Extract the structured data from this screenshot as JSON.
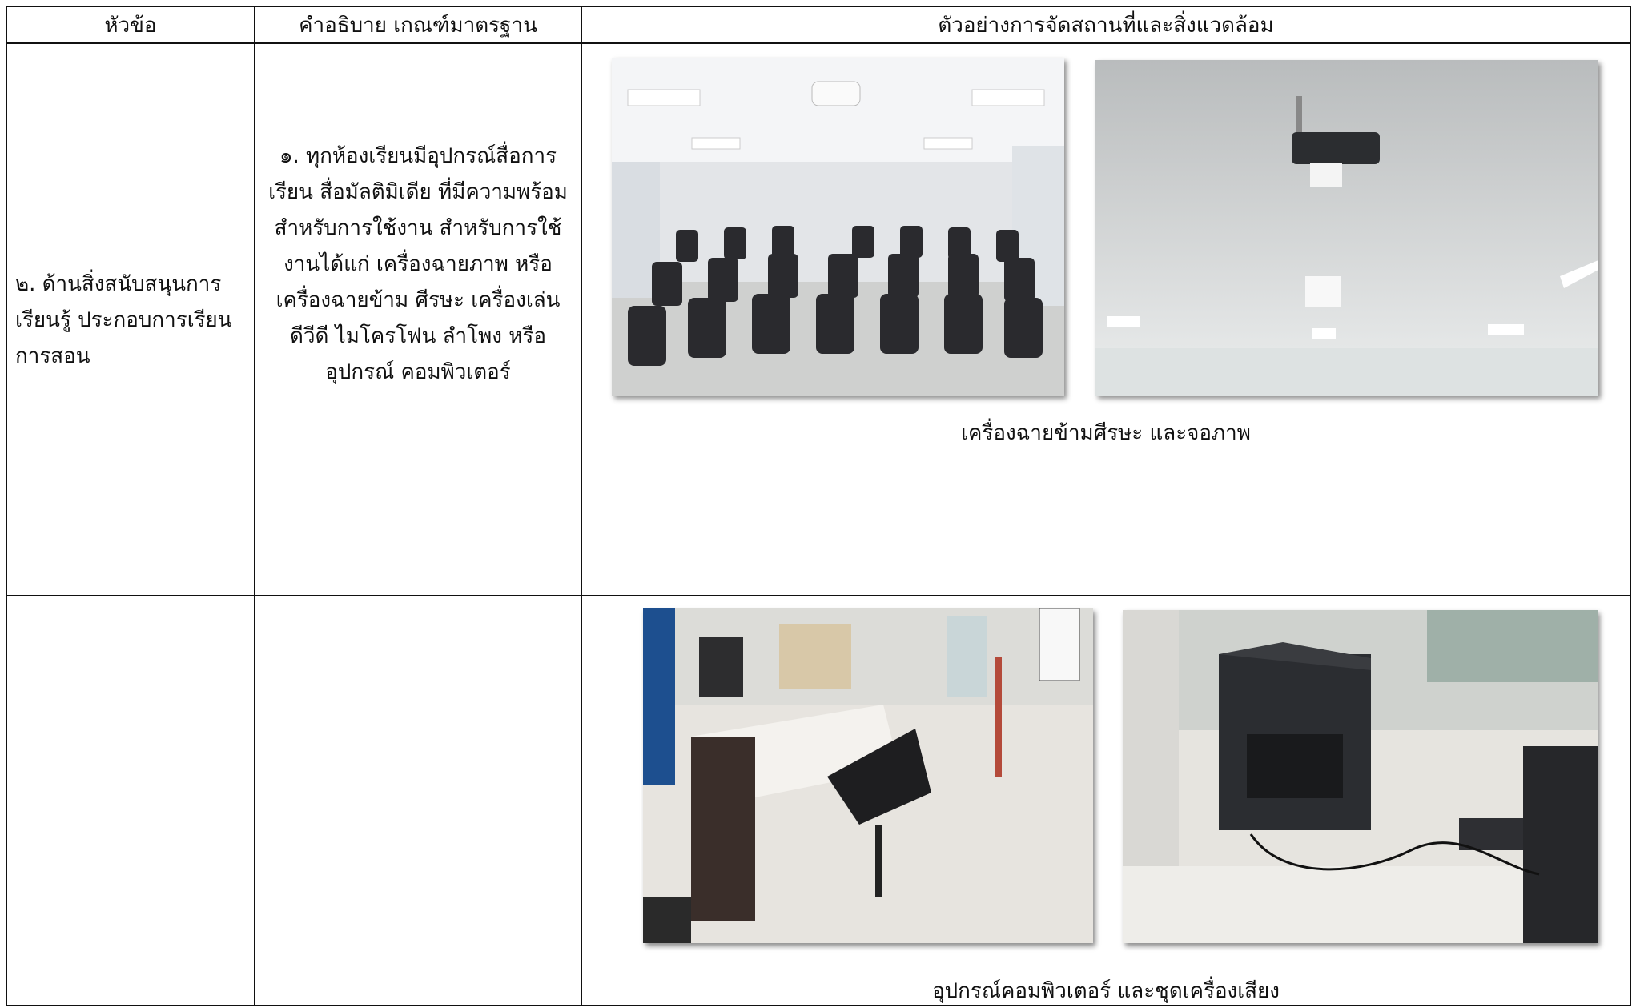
{
  "headers": {
    "topic": "หัวข้อ",
    "description": "คำอธิบาย เกณฑ์มาตรฐาน",
    "example": "ตัวอย่างการจัดสถานที่และสิ่งแวดล้อม"
  },
  "rows": [
    {
      "topic": "๒. ด้านสิ่งสนับสนุนการเรียนรู้ ประกอบการเรียนการสอน",
      "description": "๑. ทุกห้องเรียนมีอุปกรณ์สื่อการเรียน สื่อมัลติมิเดีย ที่มีความพร้อมสำหรับการใช้งาน สำหรับการใช้งานได้แก่  เครื่องฉายภาพ หรือเครื่องฉายข้าม ศีรษะ เครื่องเล่นดีวีดี ไมโครโฟน ลำโพง หรือ อุปกรณ์ คอมพิวเตอร์",
      "photos": [
        "classroom-photo",
        "ceiling-projector-photo"
      ],
      "caption": "เครื่องฉายข้ามศีรษะ และจอภาพ"
    },
    {
      "topic": "",
      "description": "",
      "photos": [
        "computer-desk-photo",
        "sound-cabinet-photo"
      ],
      "caption": "อุปกรณ์คอมพิวเตอร์ และชุดเครื่องเสียง"
    }
  ]
}
